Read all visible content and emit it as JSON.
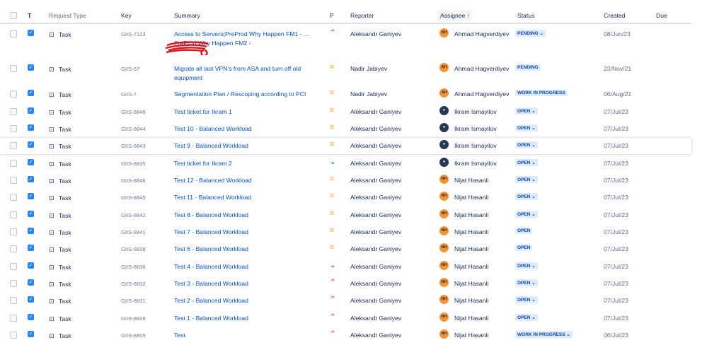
{
  "headers": {
    "t": "T",
    "request_type": "Request Type",
    "key": "Key",
    "summary": "Summary",
    "p": "P",
    "reporter": "Reporter",
    "assignee": "Assignee",
    "sort_arrow": "↑",
    "status": "Status",
    "created": "Created",
    "due": "Due"
  },
  "rows": [
    {
      "type": "Task",
      "key": "GIIS-7123",
      "summary": "Access to Servers(PreProd Why Happen FM1 - ... PreProd Why Happen FM2 -",
      "priority": "high",
      "reporter": "Aleksandr Ganiyev",
      "assignee": "Ahmad Hagverdiyev",
      "initials": "AH",
      "status": "PENDING",
      "dropdown": true,
      "created": "08/Jun/23"
    },
    {
      "type": "Task",
      "key": "GIIS-67",
      "summary": "Migrate all last VPN's from ASA and turn off old equipment",
      "priority": "medium",
      "reporter": "Nadir Jabiyev",
      "assignee": "Ahmad Hagverdiyev",
      "initials": "AH",
      "status": "PENDING",
      "dropdown": false,
      "created": "23/Nov/21"
    },
    {
      "type": "Task",
      "key": "GIIS-7",
      "summary": "Segmentation Plan / Rescoping according to PCI",
      "priority": "medium",
      "reporter": "Nadir Jabiyev",
      "assignee": "Ahmad Hagverdiyev",
      "initials": "AH",
      "status": "WORK IN PROGRESS",
      "dropdown": false,
      "created": "06/Aug/21"
    },
    {
      "type": "Task",
      "key": "GIIS-8848",
      "summary": "Test ticket for Ikram 1",
      "priority": "medium",
      "reporter": "Aleksandr Ganiyev",
      "assignee": "Ikram Ismayilov",
      "initials": "",
      "status": "OPEN",
      "dropdown": true,
      "created": "07/Jul/23"
    },
    {
      "type": "Task",
      "key": "GIIS-8844",
      "summary": "Test 10 - Balanced Workload",
      "priority": "medium",
      "reporter": "Aleksandr Ganiyev",
      "assignee": "Ikram Ismayilov",
      "initials": "",
      "status": "OPEN",
      "dropdown": true,
      "created": "07/Jul/23"
    },
    {
      "type": "Task",
      "key": "GIIS-8843",
      "summary": "Test 9 - Balanced Workload",
      "priority": "medium",
      "reporter": "Aleksandr Ganiyev",
      "assignee": "Ikram Ismayilov",
      "initials": "",
      "status": "OPEN",
      "dropdown": true,
      "created": "07/Jul/23",
      "highlight": true
    },
    {
      "type": "Task",
      "key": "GIIS-8835",
      "summary": "Test ticket for Ikram 2",
      "priority": "low",
      "reporter": "Aleksandr Ganiyev",
      "assignee": "Ikram Ismayilov",
      "initials": "",
      "status": "OPEN",
      "dropdown": true,
      "created": "07/Jul/23"
    },
    {
      "type": "Task",
      "key": "GIIS-8846",
      "summary": "Test 12 - Balanced Workload",
      "priority": "medium",
      "reporter": "Aleksandr Ganiyev",
      "assignee": "Nijat Hasanli",
      "initials": "NH",
      "status": "OPEN",
      "dropdown": true,
      "created": "07/Jul/23"
    },
    {
      "type": "Task",
      "key": "GIIS-8845",
      "summary": "Test 11 - Balanced Workload",
      "priority": "medium",
      "reporter": "Aleksandr Ganiyev",
      "assignee": "Nijat Hasanli",
      "initials": "NH",
      "status": "OPEN",
      "dropdown": true,
      "created": "07/Jul/23"
    },
    {
      "type": "Task",
      "key": "GIIS-8842",
      "summary": "Test 8 - Balanced Workload",
      "priority": "medium",
      "reporter": "Aleksandr Ganiyev",
      "assignee": "Nijat Hasanli",
      "initials": "NH",
      "status": "OPEN",
      "dropdown": true,
      "created": "07/Jul/23"
    },
    {
      "type": "Task",
      "key": "GIIS-8841",
      "summary": "Test 7 - Balanced Workload",
      "priority": "medium",
      "reporter": "Aleksandr Ganiyev",
      "assignee": "Nijat Hasanli",
      "initials": "NH",
      "status": "OPEN",
      "dropdown": false,
      "created": "07/Jul/23"
    },
    {
      "type": "Task",
      "key": "GIIS-8838",
      "summary": "Test 6 - Balanced Workload",
      "priority": "medium",
      "reporter": "Aleksandr Ganiyev",
      "assignee": "Nijat Hasanli",
      "initials": "NH",
      "status": "OPEN",
      "dropdown": false,
      "created": "07/Jul/23"
    },
    {
      "type": "Task",
      "key": "GIIS-8836",
      "summary": "Test 4 - Balanced Workload",
      "priority": "low",
      "reporter": "Aleksandr Ganiyev",
      "assignee": "Nijat Hasanli",
      "initials": "NH",
      "status": "OPEN",
      "dropdown": true,
      "created": "07/Jul/23"
    },
    {
      "type": "Task",
      "key": "GIIS-8832",
      "summary": "Test 3 - Balanced Workload",
      "priority": "high",
      "reporter": "Aleksandr Ganiyev",
      "assignee": "Nijat Hasanli",
      "initials": "NH",
      "status": "OPEN",
      "dropdown": true,
      "created": "07/Jul/23"
    },
    {
      "type": "Task",
      "key": "GIIS-8831",
      "summary": "Test 2 - Balanced Workload",
      "priority": "high",
      "reporter": "Aleksandr Ganiyev",
      "assignee": "Nijat Hasanli",
      "initials": "NH",
      "status": "OPEN",
      "dropdown": true,
      "created": "07/Jul/23"
    },
    {
      "type": "Task",
      "key": "GIIS-8828",
      "summary": "Test 1 - Balanced Workload",
      "priority": "high",
      "reporter": "Aleksandr Ganiyev",
      "assignee": "Nijat Hasanli",
      "initials": "NH",
      "status": "OPEN",
      "dropdown": true,
      "created": "07/Jul/23"
    },
    {
      "type": "Task",
      "key": "GIIS-8805",
      "summary": "Test",
      "priority": "high",
      "reporter": "Aleksandr Ganiyev",
      "assignee": "Nijat Hasanli",
      "initials": "NH",
      "status": "WORK IN PROGRESS",
      "dropdown": true,
      "created": "06/Jul/23"
    }
  ]
}
